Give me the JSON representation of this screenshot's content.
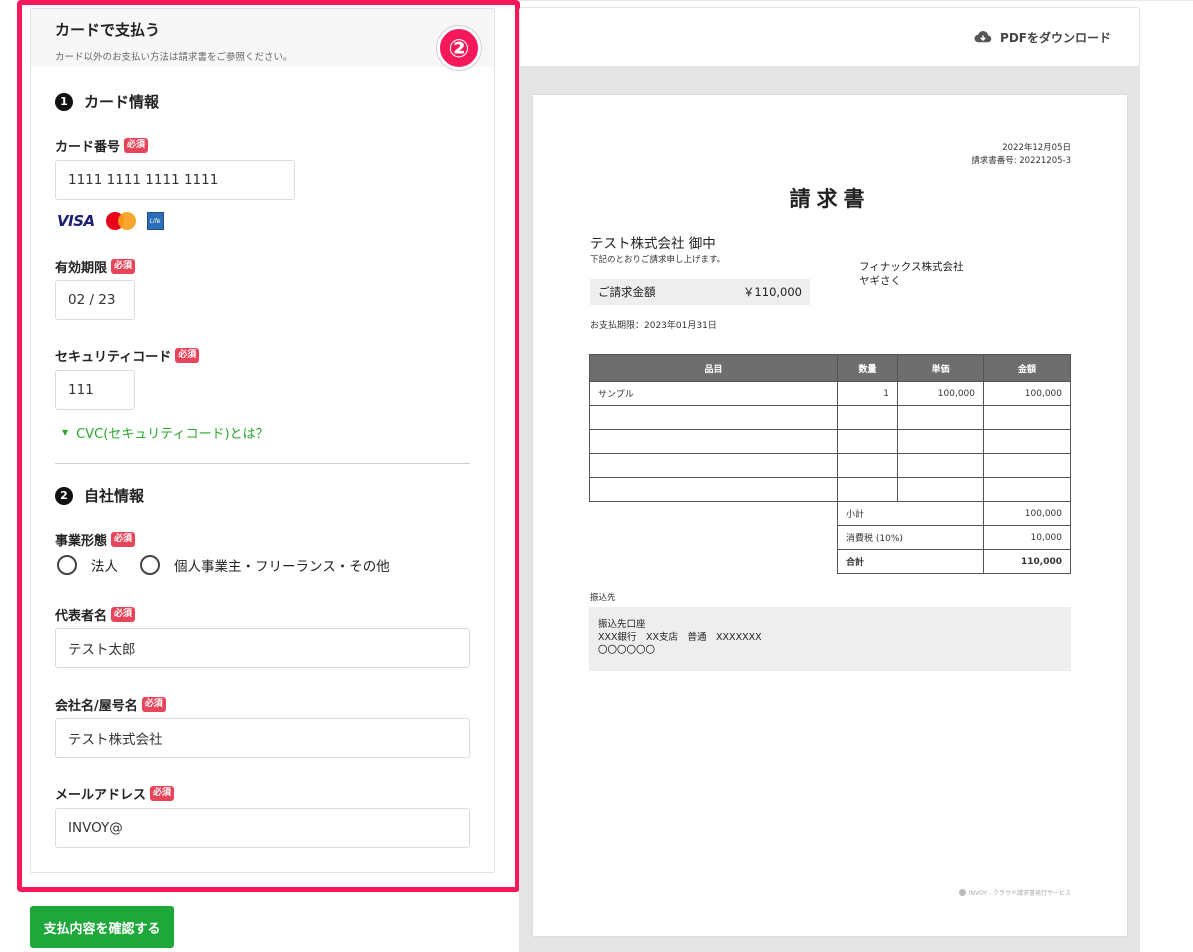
{
  "form": {
    "title": "カードで支払う",
    "subtitle": "カード以外のお支払い方法は請求書をご参照ください。",
    "step_badge": "②",
    "required_label": "必須",
    "section1": {
      "num": "1",
      "title": "カード情報"
    },
    "card_number": {
      "label": "カード番号",
      "value": "1111 1111 1111 1111"
    },
    "card_brands": [
      "VISA",
      "Mastercard",
      "Life Card"
    ],
    "life_card_text": "Life",
    "expiry": {
      "label": "有効期限",
      "value": "02 / 23"
    },
    "security_code": {
      "label": "セキュリティコード",
      "value": "111"
    },
    "cvc_link": "CVC(セキュリティコード)とは？",
    "section2": {
      "num": "2",
      "title": "自社情報"
    },
    "business_type": {
      "label": "事業形態",
      "options": [
        "法人",
        "個人事業主・フリーランス・その他"
      ]
    },
    "representative": {
      "label": "代表者名",
      "value": "テスト太郎"
    },
    "company": {
      "label": "会社名/屋号名",
      "value": "テスト株式会社"
    },
    "email": {
      "label": "メールアドレス",
      "value": "INVOY@"
    },
    "confirm_button": "支払内容を確認する",
    "highlight_color": "#f7175b",
    "accent_green": "#1fa83a"
  },
  "preview": {
    "download_label": "PDFをダウンロード",
    "invoice": {
      "date": "2022年12月05日",
      "number": "請求書番号: 20221205-3",
      "title": "請求書",
      "to": "テスト株式会社 御中",
      "to_sub": "下記のとおりご請求申し上げます。",
      "from_company": "フィナックス株式会社",
      "from_person": "ヤギさく",
      "amount_label": "ご請求金額",
      "amount_value": "￥110,000",
      "due": "お支払期限：2023年01月31日",
      "headers": [
        "品目",
        "数量",
        "単価",
        "金額"
      ],
      "rows": [
        [
          "サンプル",
          "1",
          "100,000",
          "100,000"
        ],
        [
          "",
          "",
          "",
          ""
        ],
        [
          "",
          "",
          "",
          ""
        ],
        [
          "",
          "",
          "",
          ""
        ],
        [
          "",
          "",
          "",
          ""
        ]
      ],
      "subtotal_label": "小計",
      "subtotal": "100,000",
      "tax_label": "消費税 (10%)",
      "tax": "10,000",
      "total_label": "合計",
      "total": "110,000",
      "bank_label": "振込先",
      "bank_line1": "振込先口座",
      "bank_line2": "XXX銀行　XX支店　普通　XXXXXXX",
      "bank_line3": "〇〇〇〇〇〇",
      "footer": "INVOY - クラウド請求書発行サービス"
    }
  }
}
